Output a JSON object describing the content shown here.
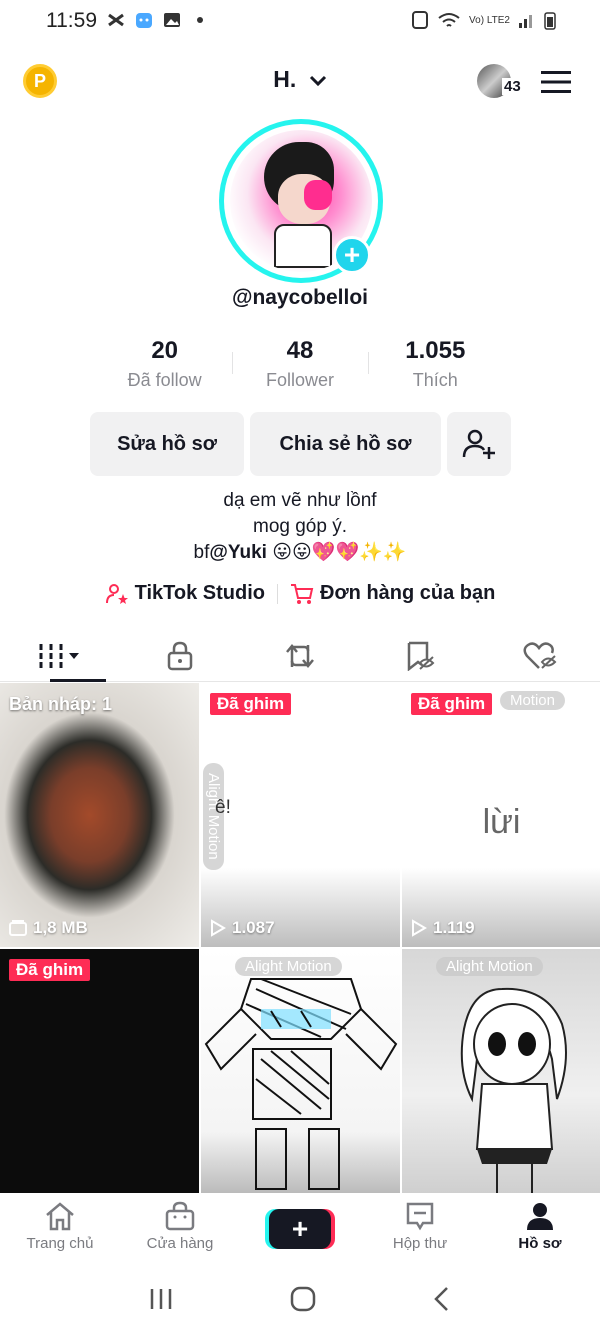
{
  "status_bar": {
    "time": "11:59",
    "network_label": "Vo) LTE2"
  },
  "header": {
    "coin_label": "P",
    "username": "H.",
    "friend_count": "43"
  },
  "profile": {
    "handle": "@naycobelloi",
    "stats": [
      {
        "value": "20",
        "label": "Đã follow"
      },
      {
        "value": "48",
        "label": "Follower"
      },
      {
        "value": "1.055",
        "label": "Thích"
      }
    ],
    "buttons": {
      "edit": "Sửa hồ sơ",
      "share": "Chia sẻ hồ sơ"
    },
    "bio": {
      "line1": "dạ em vẽ như lồnf",
      "line2": "mog góp ý.",
      "line3_prefix": "bf",
      "line3_mention": "@Yuki",
      "line3_emoji": " 😛😛💖💖✨✨"
    },
    "links": {
      "studio": "TikTok Studio",
      "orders": "Đơn hàng của bạn"
    }
  },
  "tabs": [
    "videos",
    "private",
    "reposts",
    "favorites",
    "liked"
  ],
  "grid": {
    "draft_label": "Bản nháp: 1",
    "draft_size": "1,8 MB",
    "pinned_label": "Đã ghim",
    "watermark": "Alight Motion",
    "watermark_short": "Motion",
    "cells": [
      {
        "meta": "1,8 MB"
      },
      {
        "text": "ê!",
        "meta": "1.087"
      },
      {
        "text": "lừi",
        "meta": "1.119"
      },
      {
        "meta": ""
      },
      {
        "meta": ""
      },
      {
        "meta": ""
      }
    ]
  },
  "bottom_nav": [
    {
      "label": "Trang chủ",
      "icon": "home-icon"
    },
    {
      "label": "Cửa hàng",
      "icon": "shop-icon"
    },
    {
      "label": "",
      "icon": "create-icon"
    },
    {
      "label": "Hộp thư",
      "icon": "inbox-icon"
    },
    {
      "label": "Hồ sơ",
      "icon": "profile-icon"
    }
  ],
  "colors": {
    "accent_red": "#fe2c55",
    "accent_cyan": "#25f4ee",
    "avatar_ring": "#20d5ec",
    "coin": "#f5b400"
  }
}
